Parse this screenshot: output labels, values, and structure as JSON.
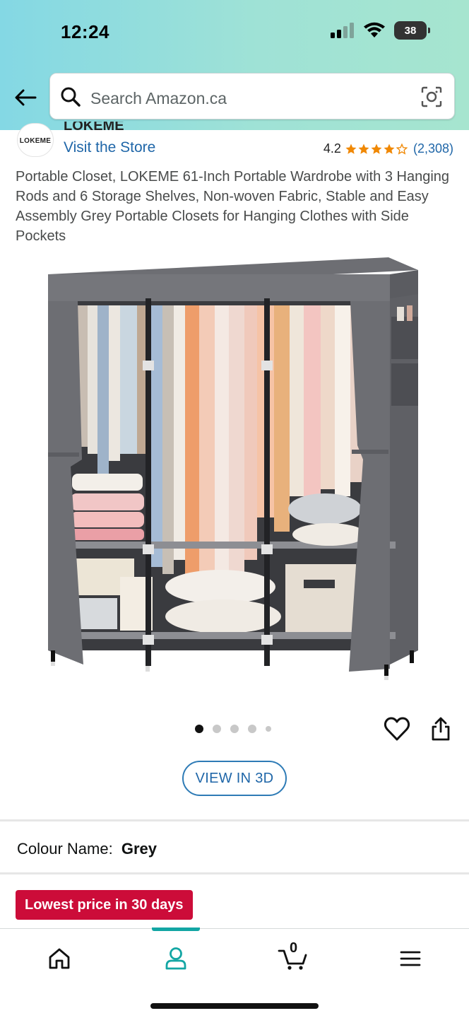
{
  "status_bar": {
    "time": "12:24",
    "battery": "38"
  },
  "search": {
    "placeholder": "Search Amazon.ca"
  },
  "store": {
    "logo_text": "LOKEME",
    "brand_partial": "LOKEME",
    "visit_label": "Visit the Store"
  },
  "rating": {
    "value": "4.2",
    "stars": 4.2,
    "count": "(2,308)"
  },
  "product": {
    "title": "Portable Closet, LOKEME 61-Inch Portable Wardrobe with 3 Hanging Rods and 6 Storage Shelves, Non-woven Fabric, Stable and Easy Assembly Grey Portable Closets for Hanging Clothes with Side Pockets"
  },
  "carousel": {
    "count": 5,
    "active": 0
  },
  "buttons": {
    "view_3d": "VIEW IN 3D"
  },
  "colour": {
    "label": "Colour Name:",
    "value": "Grey"
  },
  "deal": {
    "badge": "Lowest price in 30 days"
  },
  "bottom_nav": {
    "items": [
      "home-icon",
      "account-icon",
      "cart-icon",
      "menu-icon"
    ],
    "active": 1,
    "cart_count": "0"
  },
  "colors": {
    "accent_teal": "#13a6a4",
    "link_blue": "#1f66a8",
    "deal_red": "#cc0c39",
    "star_orange": "#f08804"
  }
}
